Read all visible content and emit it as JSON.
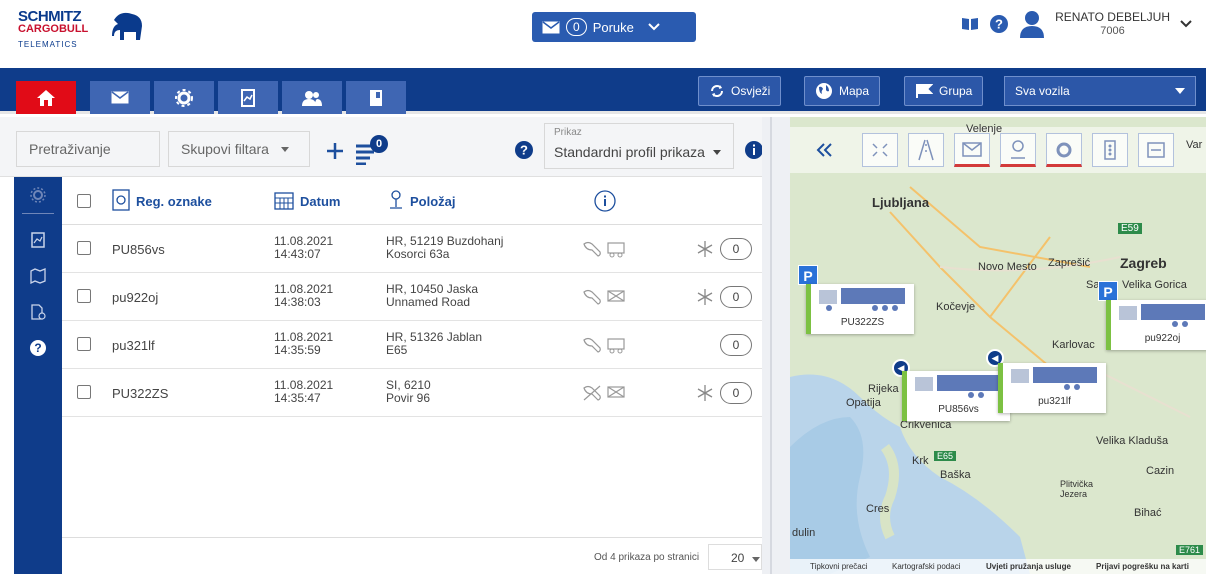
{
  "brand": {
    "line1": "SCHMITZ",
    "line2": "CARGOBULL",
    "line3": "TELEMATICS"
  },
  "messages": {
    "count": "0",
    "label": "Poruke"
  },
  "user": {
    "name": "RENATO DEBELJUH",
    "id": "7006"
  },
  "nav": {
    "refresh_label": "Osvježi",
    "map_label": "Mapa",
    "group_label": "Grupa",
    "vehicle_select": "Sva vozila"
  },
  "filters": {
    "search_placeholder": "Pretraživanje",
    "filter_groups": "Skupovi filtara",
    "badge": "0",
    "view_label": "Prikaz",
    "view_value": "Standardni profil prikaza"
  },
  "table": {
    "headers": {
      "plate": "Reg. oznake",
      "date": "Datum",
      "location": "Položaj"
    },
    "rows": [
      {
        "plate": "PU856vs",
        "date": "11.08.2021",
        "time": "14:43:07",
        "loc1": "HR, 51219 Buzdohanj",
        "loc2": "Kosorci 63a",
        "count": "0",
        "snow": true
      },
      {
        "plate": "pu922oj",
        "date": "11.08.2021",
        "time": "14:38:03",
        "loc1": "HR, 10450 Jaska",
        "loc2": "Unnamed Road",
        "count": "0",
        "snow": true
      },
      {
        "plate": "pu321lf",
        "date": "11.08.2021",
        "time": "14:35:59",
        "loc1": "HR, 51326 Jablan",
        "loc2": "E65",
        "count": "0",
        "snow": false
      },
      {
        "plate": "PU322ZS",
        "date": "11.08.2021",
        "time": "14:35:47",
        "loc1": "SI, 6210",
        "loc2": "Povir 96",
        "count": "0",
        "snow": true
      }
    ],
    "footer": {
      "per_page_label": "Od 4 prikaza po stranici",
      "per_page": "20"
    }
  },
  "map": {
    "places": {
      "ljubljana": "Ljubljana",
      "velenje": "Velenje",
      "zagreb": "Zagreb",
      "novo_mesto": "Novo Mesto",
      "zapresic": "Zaprešić",
      "velika_gorica": "Velika Gorica",
      "kocevje": "Kočevje",
      "karlovac": "Karlovac",
      "rijeka": "Rijeka",
      "opatija": "Opatija",
      "crikvenica": "Crikvenica",
      "velika_kladusa": "Velika Kladuša",
      "krk": "Krk",
      "baska": "Baška",
      "cazin": "Cazin",
      "plitvicka": "Plitvička Jezera",
      "bihac": "Bihać",
      "cres": "Cres",
      "var": "Var",
      "sar": "Sar",
      "dulin": "dulin",
      "e59": "E59",
      "e65": "E65",
      "e761": "E761"
    },
    "vehicles": {
      "v1": "PU322ZS",
      "v2": "pu922oj",
      "v3": "PU856vs",
      "v4": "pu321lf"
    },
    "footer": {
      "shortcuts": "Tipkovni prečaci",
      "data": "Kartografski podaci",
      "terms": "Uvjeti pružanja usluge",
      "report": "Prijavi pogrešku na karti"
    }
  }
}
